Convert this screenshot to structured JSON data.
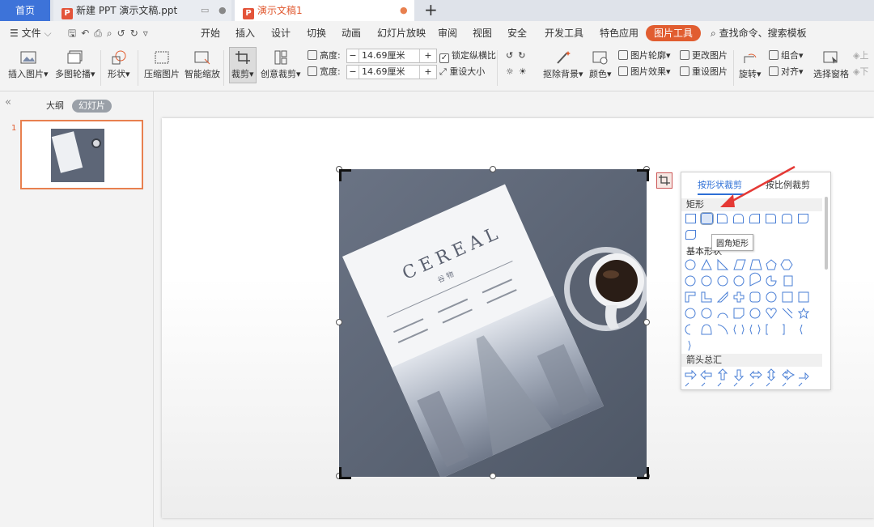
{
  "tabs": {
    "home": "首页",
    "doc1": "新建 PPT 演示文稿.ppt",
    "doc2": "演示文稿1",
    "ppt_icon": "P"
  },
  "menu": {
    "file": "文件",
    "items": [
      "开始",
      "插入",
      "设计",
      "切换",
      "动画",
      "幻灯片放映",
      "审阅",
      "视图",
      "安全",
      "开发工具",
      "特色应用"
    ],
    "active": "图片工具",
    "search": "查找命令、搜索模板"
  },
  "ribbon": {
    "insert_picture": "插入图片",
    "multi_outline": "多图轮播",
    "shape": "形状",
    "compress": "压缩图片",
    "smart_zoom": "智能缩放",
    "crop": "裁剪",
    "creative_crop": "创意裁剪",
    "height_label": "高度:",
    "height_value": "14.69厘米",
    "width_label": "宽度:",
    "width_value": "14.69厘米",
    "lock_ratio": "锁定纵横比",
    "reset_size": "重设大小",
    "remove_bg": "抠除背景",
    "color": "颜色",
    "picture_outline": "图片轮廓",
    "picture_effect": "图片效果",
    "change_picture": "更改图片",
    "reset_picture": "重设图片",
    "rotate": "旋转",
    "group": "组合",
    "align": "对齐",
    "selection_pane": "选择窗格",
    "up": "上",
    "down": "下"
  },
  "leftpanel": {
    "outline": "大纲",
    "slides": "幻灯片",
    "slide_number": "1"
  },
  "magazine": {
    "title": "CEREAL",
    "subtitle": "谷 物"
  },
  "crop_panel": {
    "tab_shape": "按形状裁剪",
    "tab_ratio": "按比例裁剪",
    "section_rect": "矩形",
    "section_basic": "基本形状",
    "section_arrow": "箭头总汇",
    "tooltip": "圆角矩形"
  },
  "colors": {
    "accent": "#e15d30",
    "home_tab": "#3d73d9",
    "link_blue": "#2e6fd6",
    "annotation_red": "#e53935"
  }
}
